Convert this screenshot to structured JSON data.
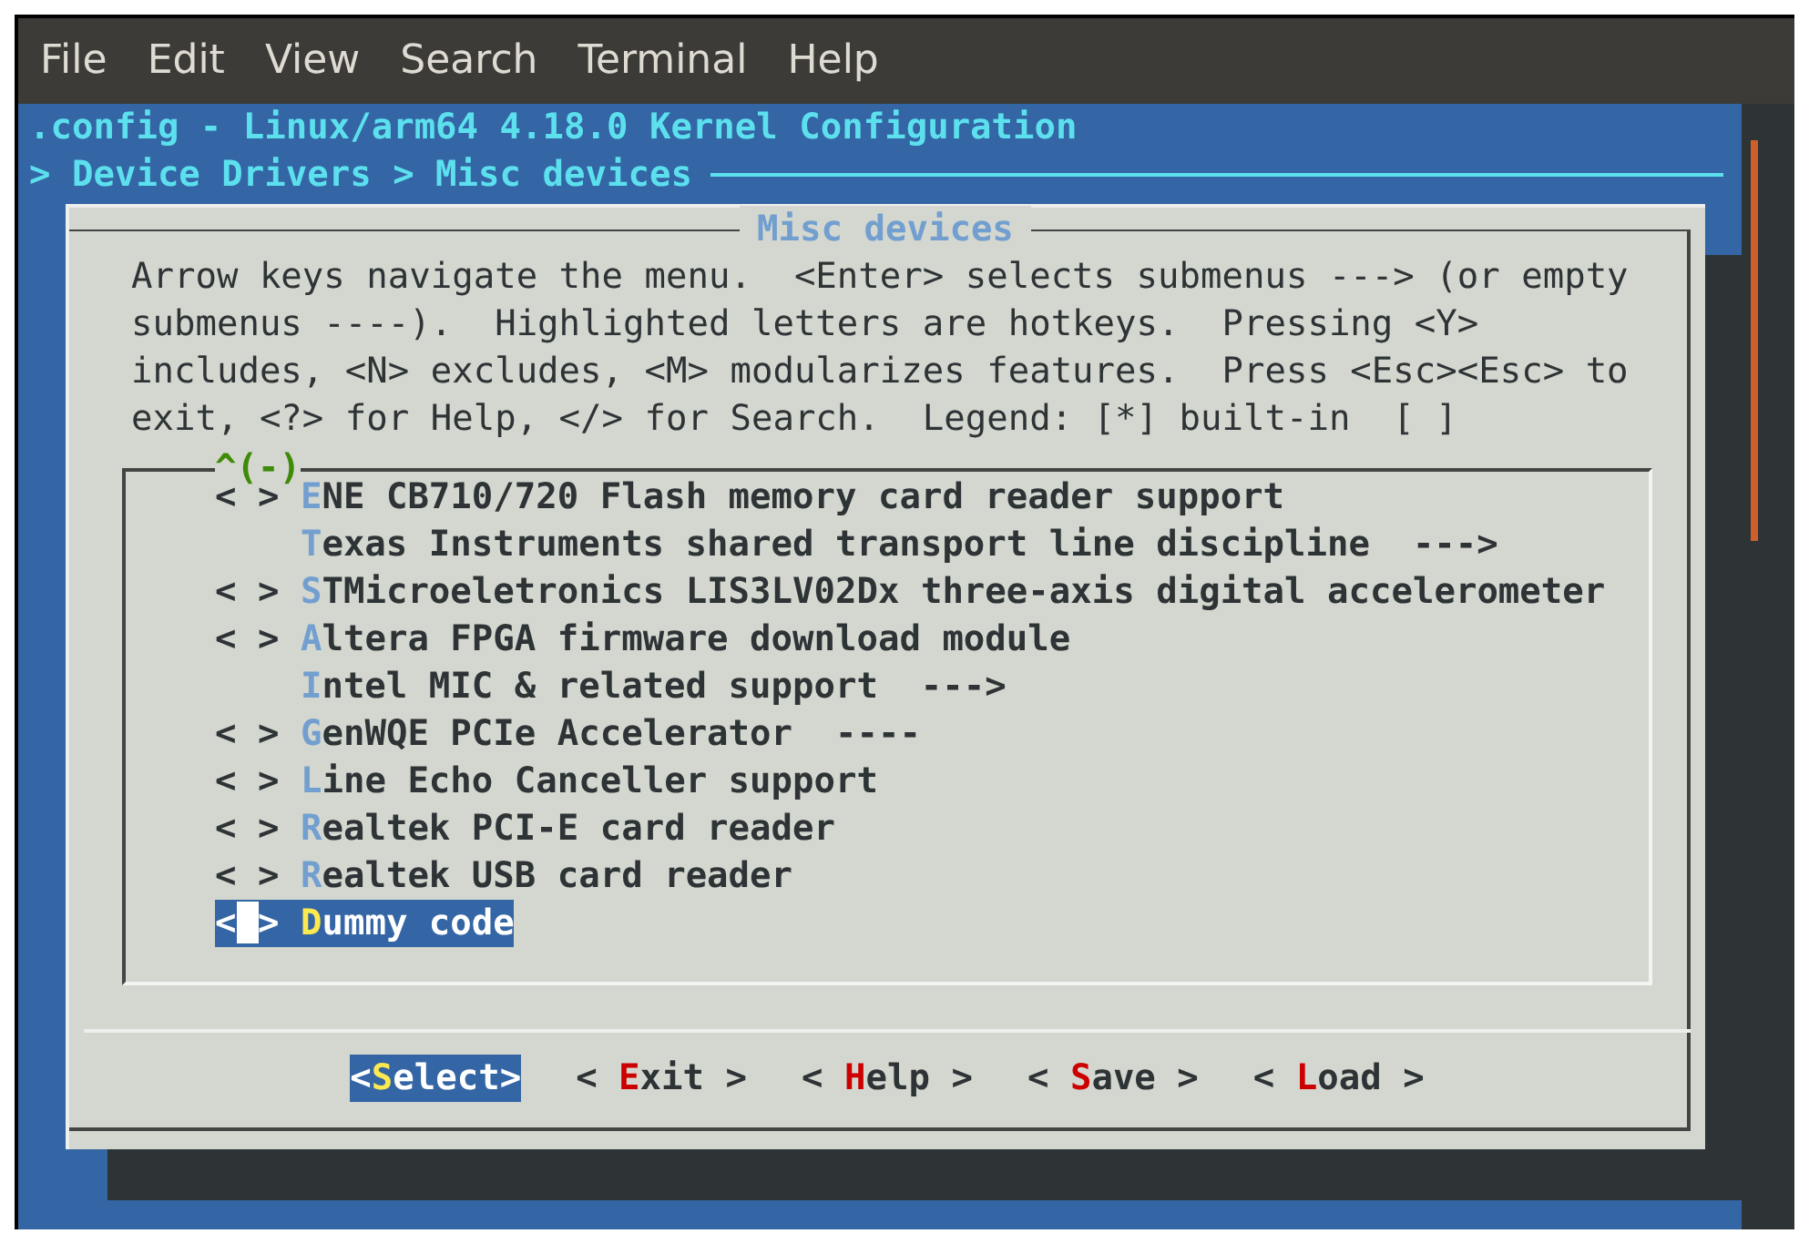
{
  "menubar": [
    "File",
    "Edit",
    "View",
    "Search",
    "Terminal",
    "Help"
  ],
  "terminal": {
    "title": ".config - Linux/arm64 4.18.0 Kernel Configuration",
    "breadcrumb": "> Device Drivers > Misc devices"
  },
  "dialog": {
    "title": "Misc devices",
    "help_lines": [
      "Arrow keys navigate the menu.  <Enter> selects submenus ---> (or empty",
      "submenus ----).  Highlighted letters are hotkeys.  Pressing <Y>",
      "includes, <N> excludes, <M> modularizes features.  Press <Esc><Esc> to",
      "exit, <?> for Help, </> for Search.  Legend: [*] built-in  [ ]"
    ],
    "scroll_indicator": "^(-)",
    "items": [
      {
        "prefix": "< >",
        "hotkey": "E",
        "rest": "NE CB710/720 Flash memory card reader support",
        "selected": false
      },
      {
        "hotkey": "T",
        "rest": "exas Instruments shared transport line discipline  --->",
        "selected": false
      },
      {
        "prefix": "< >",
        "hotkey": "S",
        "rest": "TMicroeletronics LIS3LV02Dx three-axis digital accelerometer",
        "selected": false
      },
      {
        "prefix": "< >",
        "hotkey": "A",
        "rest": "ltera FPGA firmware download module",
        "selected": false
      },
      {
        "hotkey": "I",
        "rest": "ntel MIC & related support  --->",
        "selected": false
      },
      {
        "prefix": "< >",
        "hotkey": "G",
        "rest": "enWQE PCIe Accelerator  ----",
        "selected": false
      },
      {
        "prefix": "< >",
        "hotkey": "L",
        "rest": "ine Echo Canceller support",
        "selected": false
      },
      {
        "prefix": "< >",
        "hotkey": "R",
        "rest": "ealtek PCI-E card reader",
        "selected": false
      },
      {
        "prefix": "< >",
        "hotkey": "R",
        "rest": "ealtek USB card reader",
        "selected": false
      },
      {
        "prefix": "< >",
        "hotkey": "D",
        "rest": "ummy code",
        "selected": true
      }
    ],
    "buttons": [
      {
        "open": "<",
        "hotkey": "S",
        "rest": "elect",
        "close": ">",
        "selected": true
      },
      {
        "open": "< ",
        "hotkey": "E",
        "rest": "xit",
        "close": " >",
        "selected": false
      },
      {
        "open": "< ",
        "hotkey": "H",
        "rest": "elp",
        "close": " >",
        "selected": false
      },
      {
        "open": "< ",
        "hotkey": "S",
        "rest": "ave",
        "close": " >",
        "selected": false
      },
      {
        "open": "< ",
        "hotkey": "L",
        "rest": "oad",
        "close": " >",
        "selected": false
      }
    ]
  }
}
